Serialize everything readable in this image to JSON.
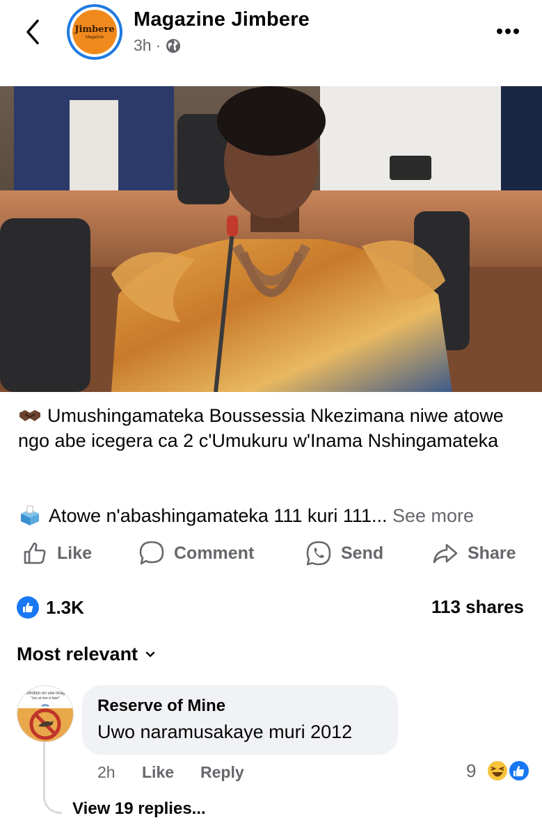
{
  "post": {
    "page_name": "Magazine Jimbere",
    "time": "3h",
    "separator": "·",
    "avatar_brand": "Jimbere",
    "avatar_sub": "Magazine",
    "caption": "Umushingamateka Boussessia Nkezimana niwe atowe ngo abe icegera ca 2 c'Umukuru w'Inama Nshingamateka",
    "caption_icon": "handshake-icon",
    "second_line": "Atowe n'abashingamateka 111 kuri 111...",
    "see_more": "See more",
    "second_line_icon": "ballot-box-icon"
  },
  "actions": {
    "like": "Like",
    "comment": "Comment",
    "send": "Send",
    "share": "Share"
  },
  "stats": {
    "reactions": "1.3K",
    "shares": "113 shares"
  },
  "comments_sort": "Most relevant",
  "comment": {
    "author": "Reserve of Mine",
    "text": "Uwo naramusakaye muri 2012",
    "time": "2h",
    "like": "Like",
    "reply": "Reply",
    "reaction_count": "9",
    "view_replies": "View 19 replies...",
    "avatar_text": "Définition en une image",
    "avatar_sub": "\"Jen ai rien à faire\""
  },
  "colors": {
    "accent": "#1877f2",
    "secondary_text": "#65676b",
    "bubble": "#f0f2f5",
    "avatar_orange": "#f08a1d"
  }
}
